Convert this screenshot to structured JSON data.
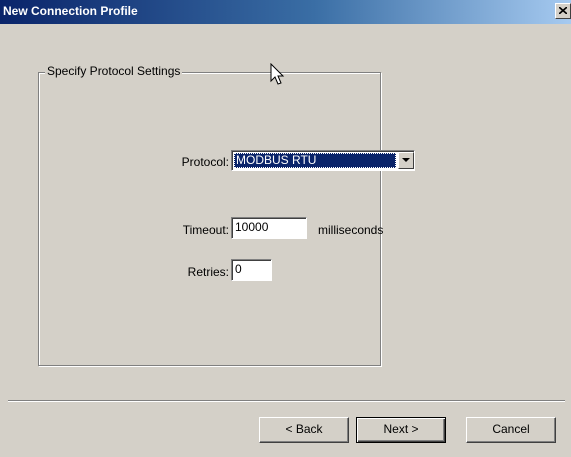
{
  "window": {
    "title": "New Connection Profile",
    "close_glyph": "✕",
    "close_icon": "close-icon"
  },
  "group": {
    "label": "Specify Protocol Settings"
  },
  "protocol": {
    "label": "Protocol:",
    "selected": "MODBUS RTU",
    "arrow_icon": "chevron-down-icon"
  },
  "timeout": {
    "label": "Timeout:",
    "value": "10000",
    "unit": "milliseconds"
  },
  "retries": {
    "label": "Retries:",
    "value": "0"
  },
  "buttons": {
    "back": "< Back",
    "next": "Next >",
    "cancel": "Cancel"
  },
  "colors": {
    "face": "#d4d0c8",
    "title_start": "#0a246a",
    "title_end": "#a6caf0",
    "selection": "#0a246a"
  },
  "cursor_icon": "mouse-pointer-icon"
}
